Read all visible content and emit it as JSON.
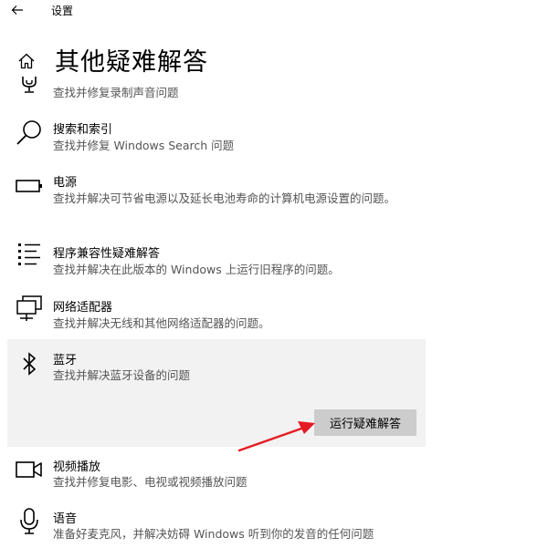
{
  "window": {
    "title": "设置"
  },
  "page": {
    "title": "其他疑难解答"
  },
  "items": [
    {
      "name": "",
      "desc": "查找并修复录制声音问题",
      "icon": "microphone-stand-icon"
    },
    {
      "name": "搜索和索引",
      "desc": "查找并修复 Windows Search 问题",
      "icon": "search-icon"
    },
    {
      "name": "电源",
      "desc": "查找并解决可节省电源以及延长电池寿命的计算机电源设置的问题。",
      "icon": "battery-icon"
    },
    {
      "name": "程序兼容性疑难解答",
      "desc": "查找并解决在此版本的 Windows 上运行旧程序的问题。",
      "icon": "list-icon"
    },
    {
      "name": "网络适配器",
      "desc": "查找并解决无线和其他网络适配器的问题。",
      "icon": "network-adapter-icon"
    },
    {
      "name": "蓝牙",
      "desc": "查找并解决蓝牙设备的问题",
      "icon": "bluetooth-icon"
    },
    {
      "name": "视频播放",
      "desc": "查找并修复电影、电视或视频播放问题",
      "icon": "video-camera-icon"
    },
    {
      "name": "语音",
      "desc": "准备好麦克风，并解决妨碍 Windows 听到你的发音的任何问题",
      "icon": "microphone-icon"
    }
  ],
  "run_button": {
    "label": "运行疑难解答"
  },
  "colors": {
    "selected_bg": "#f2f2f2",
    "button_bg": "#cccccc",
    "arrow": "#e51c23"
  }
}
